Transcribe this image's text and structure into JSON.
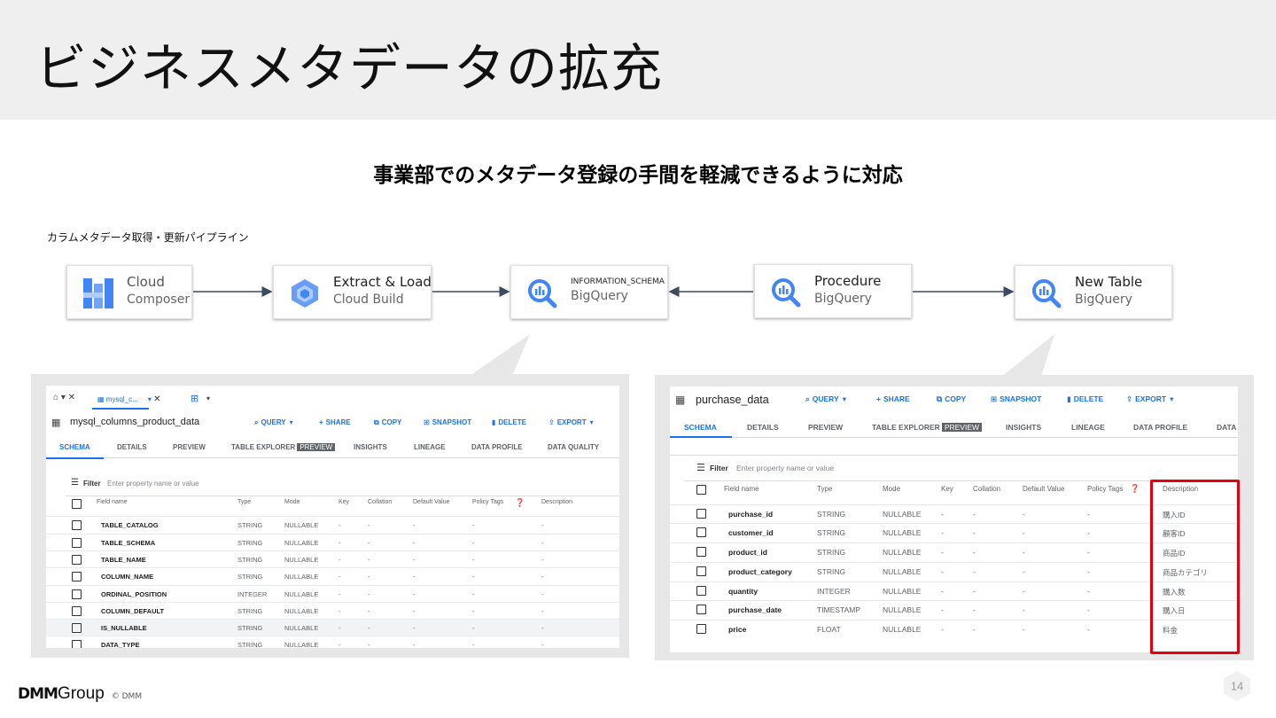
{
  "slide": {
    "title": "ビジネスメタデータの拡充",
    "subtitle": "事業部でのメタデータ登録の手間を軽減できるように対応",
    "pipeline_label": "カラムメタデータ取得・更新パイプライン",
    "page_number": "14",
    "footer": {
      "logo_dmm": "DMM",
      "logo_group": "Group",
      "copyright": "© DMM"
    }
  },
  "pipeline": {
    "nodes": [
      {
        "line1": "Cloud",
        "line2": "Composer",
        "icon": "cloud-composer-icon"
      },
      {
        "line1": "Extract & Load",
        "line2": "Cloud Build",
        "icon": "cloud-build-icon"
      },
      {
        "line1": "INFORMATION_SCHEMA",
        "line2": "BigQuery",
        "icon": "bigquery-icon"
      },
      {
        "line1": "Procedure",
        "line2": "BigQuery",
        "icon": "bigquery-icon"
      },
      {
        "line1": "New Table",
        "line2": "BigQuery",
        "icon": "bigquery-icon"
      }
    ]
  },
  "left_screenshot": {
    "tab_label": "mysql_c...",
    "table_name": "mysql_columns_product_data",
    "actions": [
      "QUERY",
      "SHARE",
      "COPY",
      "SNAPSHOT",
      "DELETE",
      "EXPORT"
    ],
    "tabs": [
      "SCHEMA",
      "DETAILS",
      "PREVIEW",
      "TABLE EXPLORER",
      "INSIGHTS",
      "LINEAGE",
      "DATA PROFILE",
      "DATA QUALITY"
    ],
    "preview_badge": "PREVIEW",
    "filter_label": "Filter",
    "filter_placeholder": "Enter property name or value",
    "columns": [
      "Field name",
      "Type",
      "Mode",
      "Key",
      "Collation",
      "Default Value",
      "Policy Tags",
      "Description"
    ],
    "rows": [
      [
        "TABLE_CATALOG",
        "STRING",
        "NULLABLE",
        "-",
        "-",
        "-",
        "-",
        "-"
      ],
      [
        "TABLE_SCHEMA",
        "STRING",
        "NULLABLE",
        "-",
        "-",
        "-",
        "-",
        "-"
      ],
      [
        "TABLE_NAME",
        "STRING",
        "NULLABLE",
        "-",
        "-",
        "-",
        "-",
        "-"
      ],
      [
        "COLUMN_NAME",
        "STRING",
        "NULLABLE",
        "-",
        "-",
        "-",
        "-",
        "-"
      ],
      [
        "ORDINAL_POSITION",
        "INTEGER",
        "NULLABLE",
        "-",
        "-",
        "-",
        "-",
        "-"
      ],
      [
        "COLUMN_DEFAULT",
        "STRING",
        "NULLABLE",
        "-",
        "-",
        "-",
        "-",
        "-"
      ],
      [
        "IS_NULLABLE",
        "STRING",
        "NULLABLE",
        "-",
        "-",
        "-",
        "-",
        "-"
      ],
      [
        "DATA_TYPE",
        "STRING",
        "NULLABLE",
        "-",
        "-",
        "-",
        "-",
        "-"
      ]
    ]
  },
  "right_screenshot": {
    "table_name": "purchase_data",
    "actions": [
      "QUERY",
      "SHARE",
      "COPY",
      "SNAPSHOT",
      "DELETE",
      "EXPORT"
    ],
    "tabs": [
      "SCHEMA",
      "DETAILS",
      "PREVIEW",
      "TABLE EXPLORER",
      "INSIGHTS",
      "LINEAGE",
      "DATA PROFILE",
      "DATA"
    ],
    "preview_badge": "PREVIEW",
    "filter_label": "Filter",
    "filter_placeholder": "Enter property name or value",
    "columns": [
      "Field name",
      "Type",
      "Mode",
      "Key",
      "Collation",
      "Default Value",
      "Policy Tags",
      "Description"
    ],
    "rows": [
      [
        "purchase_id",
        "STRING",
        "NULLABLE",
        "-",
        "-",
        "-",
        "-",
        "購入ID"
      ],
      [
        "customer_id",
        "STRING",
        "NULLABLE",
        "-",
        "-",
        "-",
        "-",
        "顧客ID"
      ],
      [
        "product_id",
        "STRING",
        "NULLABLE",
        "-",
        "-",
        "-",
        "-",
        "商品ID"
      ],
      [
        "product_category",
        "STRING",
        "NULLABLE",
        "-",
        "-",
        "-",
        "-",
        "商品カテゴリ"
      ],
      [
        "quantity",
        "INTEGER",
        "NULLABLE",
        "-",
        "-",
        "-",
        "-",
        "購入数"
      ],
      [
        "purchase_date",
        "TIMESTAMP",
        "NULLABLE",
        "-",
        "-",
        "-",
        "-",
        "購入日"
      ],
      [
        "price",
        "FLOAT",
        "NULLABLE",
        "-",
        "-",
        "-",
        "-",
        "料金"
      ]
    ]
  },
  "colors": {
    "accent": "#1a73e8",
    "highlight": "#e3000f",
    "header_bg": "#efefef"
  }
}
